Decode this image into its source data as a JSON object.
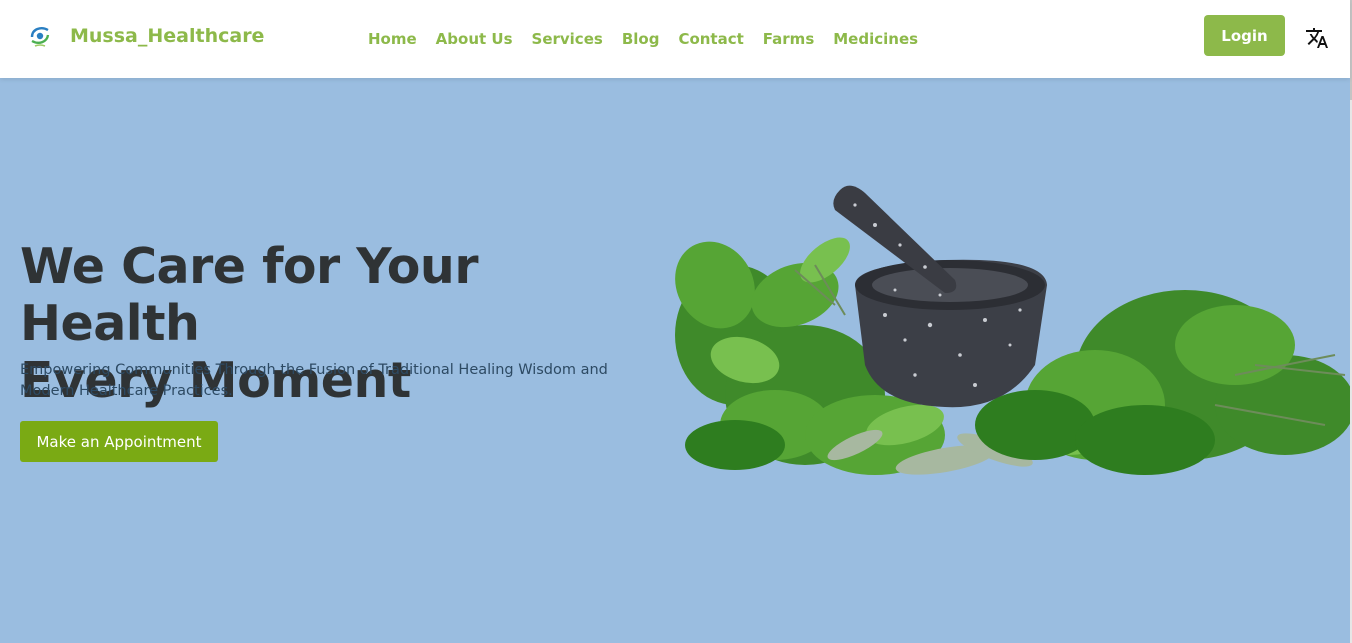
{
  "brand": {
    "name": "Mussa_Healthcare",
    "logo_icon": "leaf-swirl-logo"
  },
  "nav": {
    "links": [
      "Home",
      "About Us",
      "Services",
      "Blog",
      "Contact",
      "Farms",
      "Medicines"
    ],
    "login_label": "Login",
    "translate_icon": "translate-icon"
  },
  "hero": {
    "title_line1": "We Care for Your Health",
    "title_line2": "Every Moment",
    "subtitle_line1": "Empowering Communities Through the Fusion of Traditional Healing Wisdom and",
    "subtitle_line2": "Modern Healthcare Practices.",
    "cta_label": "Make an Appointment",
    "image_subject": "mortar-and-pestle-with-herbs"
  },
  "colors": {
    "accent": "#8db94a",
    "cta": "#7aaa14",
    "hero_bg": "#9abde0",
    "title": "#2f3335",
    "subtitle": "#2d4a63"
  }
}
